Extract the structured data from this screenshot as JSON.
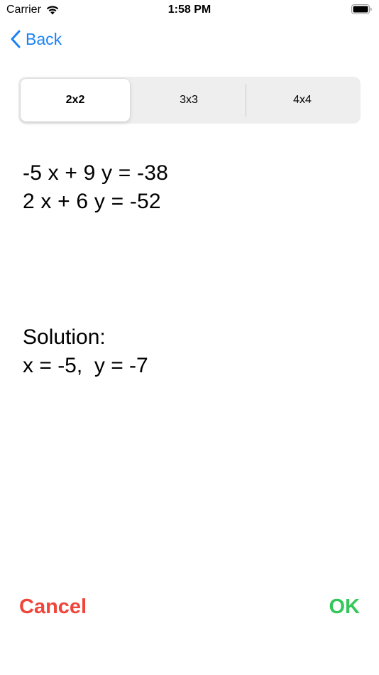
{
  "status_bar": {
    "carrier": "Carrier",
    "time": "1:58 PM",
    "wifi_icon": "wifi-icon",
    "battery_icon": "battery-icon"
  },
  "nav": {
    "back_label": "Back",
    "back_icon": "chevron-left-icon",
    "accent_color": "#1a82f7"
  },
  "segments": [
    {
      "label": "2x2",
      "selected": true
    },
    {
      "label": "3x3",
      "selected": false
    },
    {
      "label": "4x4",
      "selected": false
    }
  ],
  "equations": [
    "-5 x + 9 y = -38",
    "2 x + 6 y = -52"
  ],
  "solution": {
    "heading": "Solution:",
    "values": "x = -5,  y = -7"
  },
  "actions": {
    "cancel_label": "Cancel",
    "cancel_color": "#f0453a",
    "ok_label": "OK",
    "ok_color": "#34c759"
  }
}
